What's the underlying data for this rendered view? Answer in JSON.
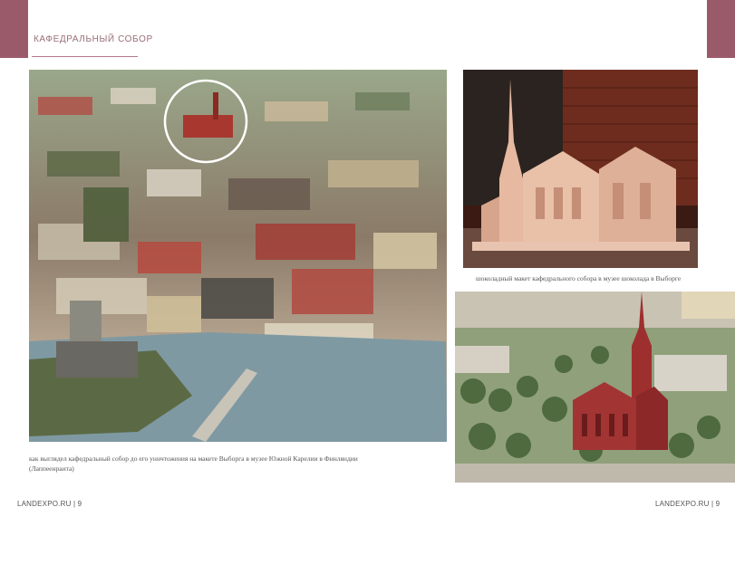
{
  "header": {
    "section_title": "КАФЕДРАЛЬНЫЙ СОБОР"
  },
  "captions": {
    "main_photo": "как выглядел кафедральный собор до его уничтожения на макете Выборга в музее Южной Карелии в Финляндии (Лаппеенранта)",
    "chocolate_photo": "шоколадный макет кафедрального собора в музее шоколада в Выборге"
  },
  "footer": {
    "left": "LANDEXPO.RU | 9",
    "right": "LANDEXPO.RU | 9"
  },
  "colors": {
    "accent": "#9b5a6a"
  }
}
